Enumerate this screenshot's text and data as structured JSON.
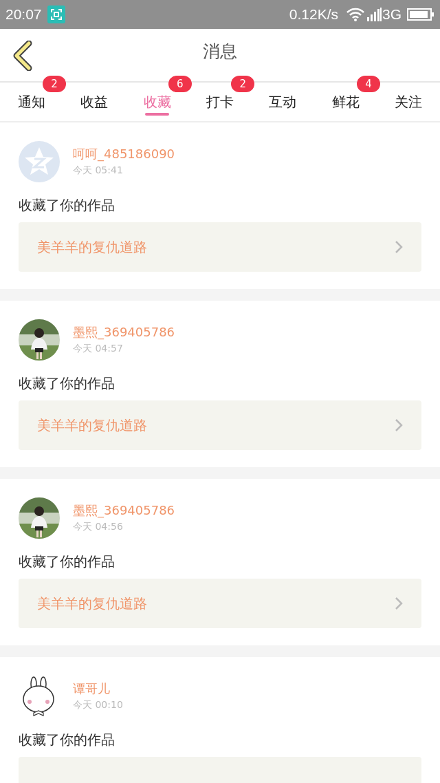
{
  "status_bar": {
    "time": "20:07",
    "speed": "0.12K/s",
    "network": "3G"
  },
  "header": {
    "title": "消息"
  },
  "tabs": [
    {
      "label": "通知",
      "badge": "2",
      "selected": false
    },
    {
      "label": "收益",
      "selected": false
    },
    {
      "label": "收藏",
      "badge": "6",
      "selected": true
    },
    {
      "label": "打卡",
      "badge": "2",
      "selected": false
    },
    {
      "label": "互动",
      "selected": false
    },
    {
      "label": "鲜花",
      "badge": "4",
      "selected": false
    },
    {
      "label": "关注",
      "selected": false
    }
  ],
  "messages": [
    {
      "kind": "default",
      "name": "呵呵_485186090",
      "time": "今天 05:41",
      "text": "收藏了你的作品",
      "work": "美羊羊的复仇道路"
    },
    {
      "name": "墨熙_369405786",
      "time": "今天 04:57",
      "text": "收藏了你的作品",
      "work": "美羊羊的复仇道路"
    },
    {
      "name": "墨熙_369405786",
      "time": "今天 04:56",
      "text": "收藏了你的作品",
      "work": "美羊羊的复仇道路"
    },
    {
      "kind": "cartoon",
      "name": "谭哥儿",
      "time": "今天 00:10",
      "text": "收藏了你的作品"
    }
  ]
}
